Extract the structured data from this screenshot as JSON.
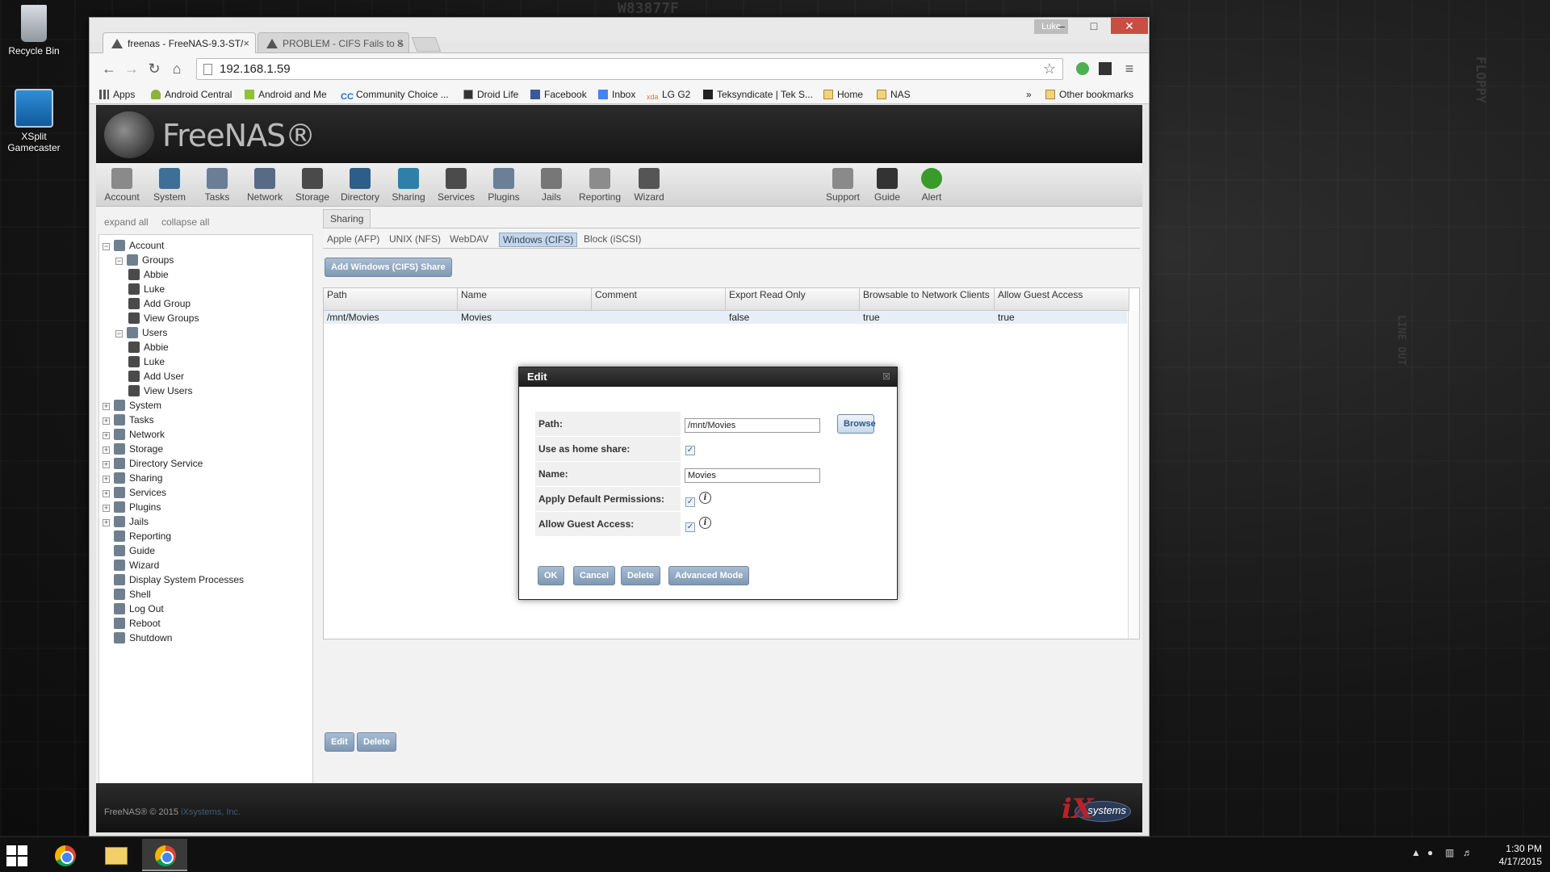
{
  "desktop": {
    "icons": [
      {
        "label": "Recycle Bin"
      },
      {
        "label": "XSplit Gamecaster"
      }
    ],
    "wallpaper_text": [
      "W83877F",
      "FLOPPY",
      "LINE OUT"
    ]
  },
  "browser": {
    "user_badge": "Luke",
    "tabs": [
      {
        "title": "freenas - FreeNAS-9.3-ST/",
        "active": true
      },
      {
        "title": "PROBLEM - CIFS Fails to S",
        "active": false
      }
    ],
    "url": "192.168.1.59",
    "bookmarks": [
      {
        "label": "Apps",
        "icon": "apps-grid-icon"
      },
      {
        "label": "Android Central",
        "icon": "android-icon"
      },
      {
        "label": "Android and Me",
        "icon": "android-icon"
      },
      {
        "label": "Community Choice ...",
        "icon": "cc-icon"
      },
      {
        "label": "Droid Life",
        "icon": "droid-icon"
      },
      {
        "label": "Facebook",
        "icon": "facebook-icon"
      },
      {
        "label": "Inbox",
        "icon": "inbox-icon"
      },
      {
        "label": "LG G2",
        "icon": "xda-icon"
      },
      {
        "label": "Teksyndicate | Tek S...",
        "icon": "tek-icon"
      },
      {
        "label": "Home",
        "icon": "folder-icon"
      },
      {
        "label": "NAS",
        "icon": "folder-icon"
      }
    ],
    "overflow": "»",
    "other_bookmarks": "Other bookmarks"
  },
  "freenas": {
    "logo_text": "FreeNAS®",
    "top_nav": [
      "Account",
      "System",
      "Tasks",
      "Network",
      "Storage",
      "Directory",
      "Sharing",
      "Services",
      "Plugins",
      "Jails",
      "Reporting",
      "Wizard"
    ],
    "top_nav_right": [
      "Support",
      "Guide",
      "Alert"
    ],
    "tree_controls": {
      "expand": "expand all",
      "collapse": "collapse all"
    },
    "tree": [
      {
        "label": "Account",
        "level": 0,
        "toggle": "−"
      },
      {
        "label": "Groups",
        "level": 1,
        "toggle": "−"
      },
      {
        "label": "Abbie",
        "level": 2
      },
      {
        "label": "Luke",
        "level": 2
      },
      {
        "label": "Add Group",
        "level": 2
      },
      {
        "label": "View Groups",
        "level": 2
      },
      {
        "label": "Users",
        "level": 1,
        "toggle": "−"
      },
      {
        "label": "Abbie",
        "level": 2
      },
      {
        "label": "Luke",
        "level": 2
      },
      {
        "label": "Add User",
        "level": 2
      },
      {
        "label": "View Users",
        "level": 2
      },
      {
        "label": "System",
        "level": 0,
        "toggle": "+"
      },
      {
        "label": "Tasks",
        "level": 0,
        "toggle": "+"
      },
      {
        "label": "Network",
        "level": 0,
        "toggle": "+"
      },
      {
        "label": "Storage",
        "level": 0,
        "toggle": "+"
      },
      {
        "label": "Directory Service",
        "level": 0,
        "toggle": "+"
      },
      {
        "label": "Sharing",
        "level": 0,
        "toggle": "+"
      },
      {
        "label": "Services",
        "level": 0,
        "toggle": "+"
      },
      {
        "label": "Plugins",
        "level": 0,
        "toggle": "+"
      },
      {
        "label": "Jails",
        "level": 0,
        "toggle": "+"
      },
      {
        "label": "Reporting",
        "level": 0
      },
      {
        "label": "Guide",
        "level": 0
      },
      {
        "label": "Wizard",
        "level": 0
      },
      {
        "label": "Display System Processes",
        "level": 0
      },
      {
        "label": "Shell",
        "level": 0
      },
      {
        "label": "Log Out",
        "level": 0
      },
      {
        "label": "Reboot",
        "level": 0
      },
      {
        "label": "Shutdown",
        "level": 0
      }
    ],
    "content_tab": "Sharing",
    "sub_tabs": [
      "Apple (AFP)",
      "UNIX (NFS)",
      "WebDAV",
      "Windows (CIFS)",
      "Block (iSCSI)"
    ],
    "selected_sub_tab": "Windows (CIFS)",
    "add_button": "Add Windows (CIFS) Share",
    "grid": {
      "headers": [
        "Path",
        "Name",
        "Comment",
        "Export Read Only",
        "Browsable to Network Clients",
        "Allow Guest Access"
      ],
      "rows": [
        [
          "/mnt/Movies",
          "Movies",
          "",
          "false",
          "true",
          "true"
        ]
      ]
    },
    "bottom_buttons": {
      "edit": "Edit",
      "delete": "Delete"
    },
    "footer": {
      "copyright": "FreeNAS® © 2015 ",
      "company": "iXsystems, Inc.",
      "logo_text": "systems"
    }
  },
  "modal": {
    "title": "Edit",
    "close": "☒",
    "path_label": "Path:",
    "path_value": "/mnt/Movies",
    "browse": "Browse",
    "home_share_label": "Use as home share:",
    "home_share_checked": true,
    "name_label": "Name:",
    "name_value": "Movies",
    "default_perm_label": "Apply Default Permissions:",
    "default_perm_checked": true,
    "guest_label": "Allow Guest Access:",
    "guest_checked": true,
    "buttons": {
      "ok": "OK",
      "cancel": "Cancel",
      "delete": "Delete",
      "advanced": "Advanced Mode"
    }
  },
  "taskbar": {
    "time": "1:30 PM",
    "date": "4/17/2015"
  }
}
